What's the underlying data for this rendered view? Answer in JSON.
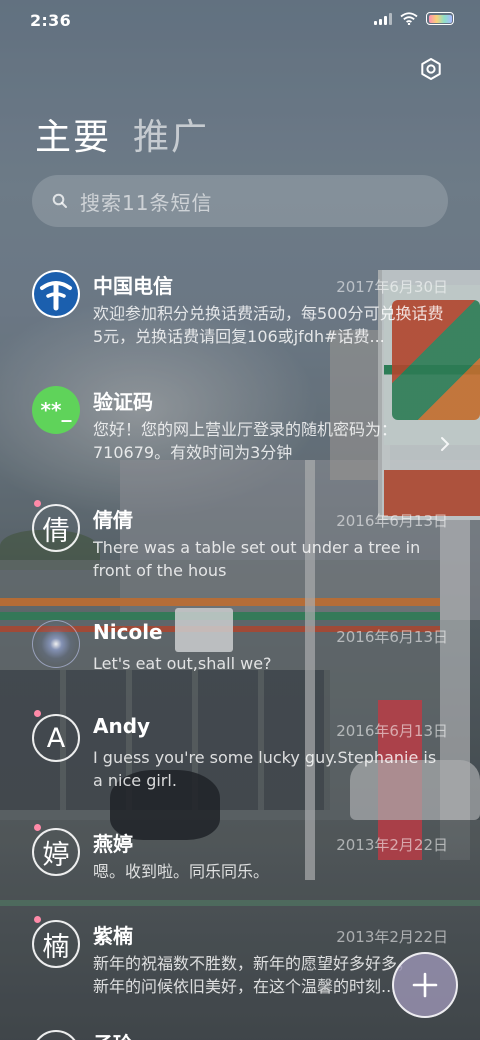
{
  "status_bar": {
    "time": "2:36"
  },
  "header": {
    "tabs": [
      {
        "label": "主要",
        "active": true
      },
      {
        "label": "推广",
        "active": false
      }
    ],
    "settings_icon": "gear-icon"
  },
  "search": {
    "placeholder": "搜索11条短信",
    "icon": "search-icon"
  },
  "messages": [
    {
      "name": "中国电信",
      "date": "2017年6月30日",
      "preview": "欢迎参加积分兑换话费活动，每500分可兑换话费5元，兑换话费请回复106或jfdh#话费...",
      "avatar": "china-telecom-logo"
    },
    {
      "name": "验证码",
      "date": "",
      "preview": "您好！您的网上营业厅登录的随机密码为：710679。有效时间为3分钟",
      "avatar_text": "**_"
    },
    {
      "name": "倩倩",
      "date": "2016年6月13日",
      "preview": "There was a table set out under a tree in front of the hous",
      "avatar_text": "倩"
    },
    {
      "name": "Nicole",
      "date": "2016年6月13日",
      "preview": "Let's eat out,shall we?",
      "avatar": "glow-avatar"
    },
    {
      "name": "Andy",
      "date": "2016年6月13日",
      "preview": "I guess you're some lucky guy.Stephanie is a nice girl.",
      "avatar_text": "A"
    },
    {
      "name": "燕婷",
      "date": "2013年2月22日",
      "preview": "嗯。收到啦。同乐同乐。",
      "avatar_text": "婷"
    },
    {
      "name": "紫楠",
      "date": "2013年2月22日",
      "preview": "新年的祝福数不胜数，新年的愿望好多好多，新年的问候依旧美好，在这个温馨的时刻...",
      "avatar_text": "楠"
    },
    {
      "name": "子玲",
      "date": "",
      "preview": "",
      "avatar_text": ""
    }
  ],
  "fab": {
    "icon": "plus-icon"
  },
  "colors": {
    "verify_green": "#5fd35a",
    "telecom_blue": "#1b5fae",
    "badge_pink": "#ff8aa8"
  }
}
